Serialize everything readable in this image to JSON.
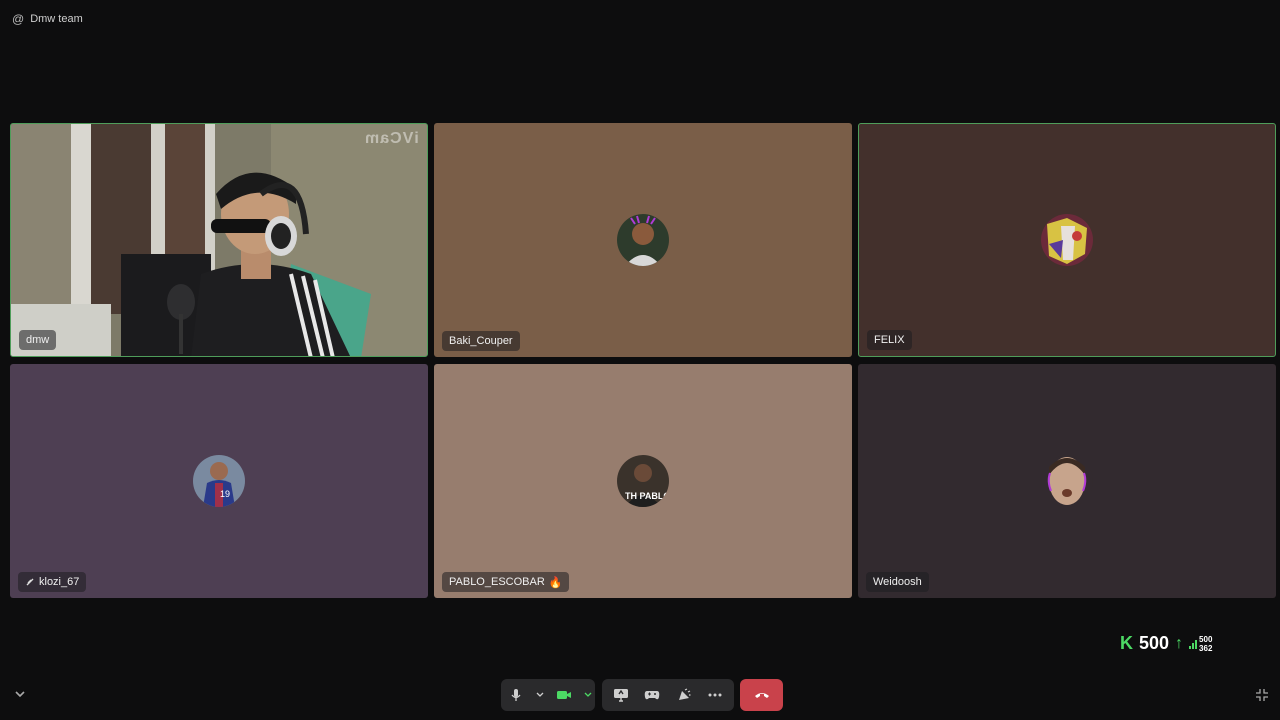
{
  "header": {
    "at_symbol": "@",
    "team_name": "Dmw team"
  },
  "tiles": [
    {
      "name": "dmw",
      "watermark": "iVCam",
      "bg": "#6a6a63",
      "speaking": true,
      "has_video": true
    },
    {
      "name": "Baki_Couper",
      "bg": "#7a5e48",
      "speaking": false,
      "avatar_bg": "#2a3a2a"
    },
    {
      "name": "FELIX",
      "bg": "#43302c",
      "speaking": true,
      "avatar_bg": "#7a3040"
    },
    {
      "name": "klozi_67",
      "bg": "#4e3f53",
      "speaking": false,
      "muted": true,
      "avatar_bg": "#3a3a7a"
    },
    {
      "name": "PABLO_ESCOBAR",
      "name_suffix": "🔥",
      "bg": "#977d6e",
      "speaking": false,
      "avatar_bg": "#3b332c"
    },
    {
      "name": "Weidoosh",
      "bg": "#322a2f",
      "speaking": false,
      "avatar_bg": "#6a5a50"
    }
  ],
  "stats": {
    "logo": "K",
    "value": "500",
    "arrow": "↑",
    "top": "500",
    "bottom": "362"
  },
  "colors": {
    "accent_green": "#4cd964",
    "end_call": "#c9424b",
    "speaking_border": "#4f9d5a"
  }
}
